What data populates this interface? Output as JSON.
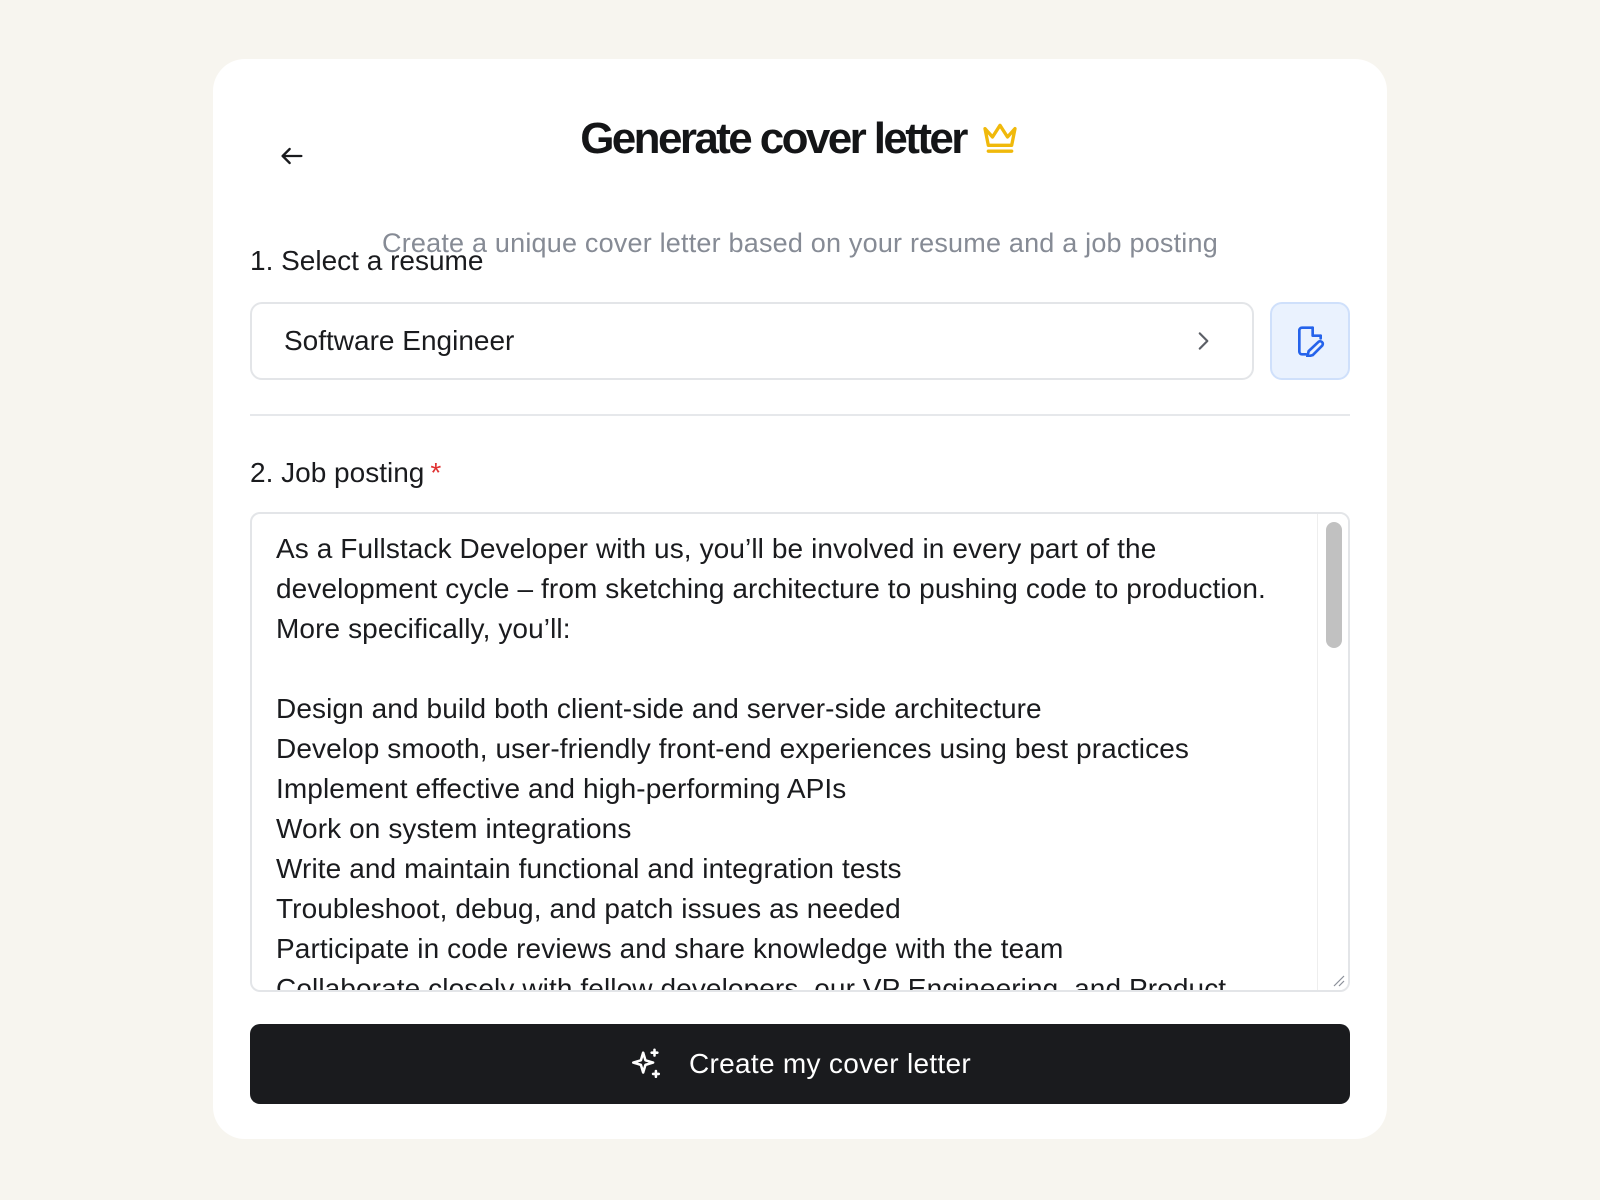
{
  "page": {
    "title": "Generate cover letter",
    "subtitle": "Create a unique cover letter based on your resume and a job posting"
  },
  "icons": {
    "back": "arrow-left-icon",
    "crown": "crown-icon",
    "chevron": "chevron-right-icon",
    "file_edit": "file-edit-icon",
    "sparkles": "sparkles-icon"
  },
  "resume_section": {
    "label": "1. Select a resume",
    "selected_value": "Software Engineer"
  },
  "job_section": {
    "label": "2. Job posting",
    "required_marker": "*",
    "text": "As a Fullstack Developer with us, you’ll be involved in every part of the development cycle – from sketching architecture to pushing code to production. More specifically, you’ll:\n\nDesign and build both client-side and server-side architecture\nDevelop smooth, user-friendly front-end experiences using best practices\nImplement effective and high-performing APIs\nWork on system integrations\nWrite and maintain functional and integration tests\nTroubleshoot, debug, and patch issues as needed\nParticipate in code reviews and share knowledge with the team\nCollaborate closely with fellow developers, our VP Engineering, and Product"
  },
  "actions": {
    "create_label": "Create my cover letter"
  },
  "colors": {
    "background": "#f7f5ef",
    "card": "#ffffff",
    "crown": "#f0b90b",
    "accent_blue": "#2563eb",
    "primary_button": "#1a1b1e",
    "required": "#e03131"
  }
}
